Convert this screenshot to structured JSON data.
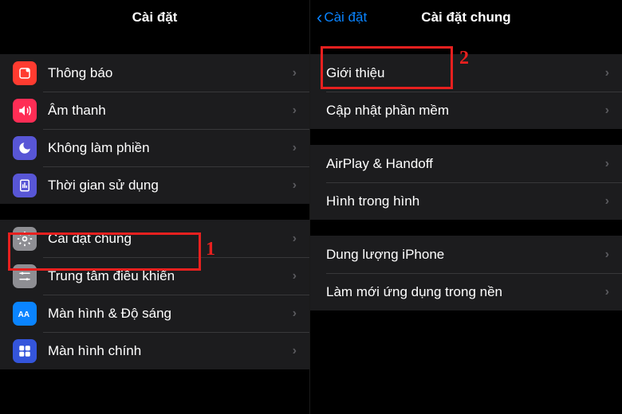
{
  "left": {
    "title": "Cài đặt",
    "groups": [
      [
        {
          "label": "Thông báo",
          "icon": "notifications",
          "bg": "#ff3b30"
        },
        {
          "label": "Âm thanh",
          "icon": "sounds",
          "bg": "#ff2d55"
        },
        {
          "label": "Không làm phiền",
          "icon": "dnd",
          "bg": "#5856d6"
        },
        {
          "label": "Thời gian sử dụng",
          "icon": "screentime",
          "bg": "#5856d6"
        }
      ],
      [
        {
          "label": "Cài đặt chung",
          "icon": "general",
          "bg": "#8e8e93"
        },
        {
          "label": "Trung tâm điều khiển",
          "icon": "control",
          "bg": "#8e8e93"
        },
        {
          "label": "Màn hình & Độ sáng",
          "icon": "display",
          "bg": "#0a84ff"
        },
        {
          "label": "Màn hình chính",
          "icon": "home",
          "bg": "#3455db"
        }
      ]
    ]
  },
  "right": {
    "back": "Cài đặt",
    "title": "Cài đặt chung",
    "groups": [
      [
        {
          "label": "Giới thiệu"
        },
        {
          "label": "Cập nhật phần mềm"
        }
      ],
      [
        {
          "label": "AirPlay & Handoff"
        },
        {
          "label": "Hình trong hình"
        }
      ],
      [
        {
          "label": "Dung lượng iPhone"
        },
        {
          "label": "Làm mới ứng dụng trong nền"
        }
      ]
    ]
  },
  "annotations": {
    "a1": "1",
    "a2": "2"
  }
}
